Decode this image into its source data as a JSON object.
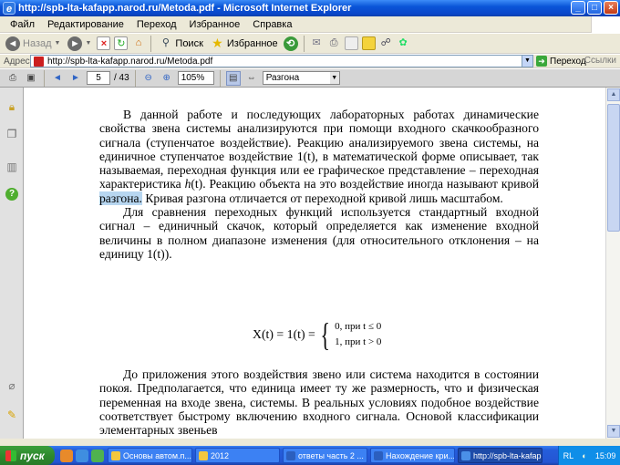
{
  "window": {
    "title": "http://spb-lta-kafapp.narod.ru/Metoda.pdf - Microsoft Internet Explorer"
  },
  "menu": [
    "Файл",
    "Редактирование",
    "Переход",
    "Избранное",
    "Справка"
  ],
  "toolbar": {
    "back_label": "Назад",
    "search_label": "Поиск",
    "favorites_label": "Избранное"
  },
  "address": {
    "label": "Адрес:",
    "url": "http://spb-lta-kafapp.narod.ru/Metoda.pdf",
    "go_label": "Переход",
    "links_label": "Ссылки"
  },
  "pdf": {
    "page_current": "5",
    "page_total": "/ 43",
    "zoom": "105%",
    "search_value": "Разгона"
  },
  "document": {
    "para1_before": "В данной работе и последующих лабораторных работах динамические свойства звена системы анализируются при помощи входного скачкообразного сигнала (ступенчатое воздействие). Реакцию анализируемого звена системы, на единичное ступенчатое воздействие 1(t), в математической форме описывает, так называемая, переходная функция или ее графическое представление – переходная характеристика ",
    "para1_h": "h",
    "para1_mid": "(t). Реакцию объекта на это воздействие иногда называют кривой ",
    "para1_highlight": "разгона.",
    "para1_after": " Кривая разгона отличается от переходной кривой лишь масштабом.",
    "para2": "Для сравнения переходных функций используется стандартный входной сигнал – единичный скачок, который определяется как изменение входной величины в полном диапазоне изменения (для относительного отклонения – на единицу 1(t)).",
    "formula_lhs": "X(t) = 1(t) =",
    "formula_case1": "0, при t ≤ 0",
    "formula_case2": "1, при t > 0",
    "para3": "До приложения этого воздействия звено или система находится в состоянии покоя. Предполагается, что единица имеет ту же размерность, что и физическая переменная на входе звена, системы. В реальных условиях подобное воздействие соответствует быстрому включению входного сигнала. Основой классификации элементарных звеньев"
  },
  "taskbar": {
    "start_label": "пуск",
    "tasks": [
      "Основы автом.п...",
      "2012",
      "ответы часть 2 ...",
      "Нахождение кри...",
      "http://spb-lta-kafapp..."
    ],
    "lang": "RL",
    "clock": "15:09"
  }
}
